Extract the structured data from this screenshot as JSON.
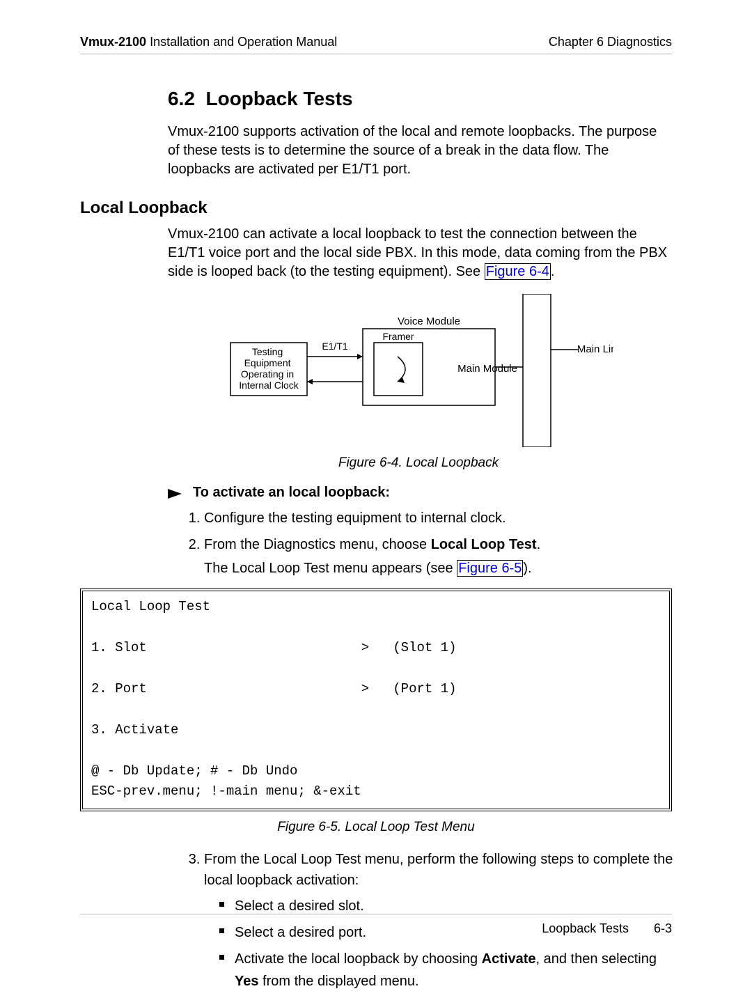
{
  "header": {
    "product": "Vmux-2100",
    "manual": " Installation and Operation Manual",
    "chapter": "Chapter 6  Diagnostics"
  },
  "section": {
    "number": "6.2",
    "title": "Loopback Tests",
    "intro": "Vmux-2100 supports activation of the local and remote loopbacks. The purpose of these tests is to determine the source of a break in the data flow. The loopbacks are activated per E1/T1 port."
  },
  "sub": {
    "title": "Local Loopback",
    "para_a": "Vmux-2100 can activate a local loopback to test the connection between the E1/T1 voice port and the local side PBX. In this mode, data coming from the PBX side is looped back (to the testing equipment). See ",
    "para_ref": "Figure 6-4",
    "para_b": "."
  },
  "diagram": {
    "testing": "Testing\nEquipment\nOperating in\nInternal Clock",
    "e1t1": "E1/T1",
    "voice": "Voice Module",
    "framer": "Framer",
    "mainmod": "Main Module",
    "mainlink": "Main Link"
  },
  "fig4": "Figure 6-4.  Local Loopback",
  "proc": {
    "lead": "To activate an local loopback:",
    "s1": "Configure the testing equipment to internal clock.",
    "s2a": "From the Diagnostics menu, choose ",
    "s2b": "Local Loop Test",
    "s2c": ".",
    "s2d": "The Local Loop Test menu appears (see ",
    "s2ref": "Figure 6-5",
    "s2e": ")."
  },
  "terminal": "Local Loop Test\n\n1. Slot                           >   (Slot 1)\n\n2. Port                           >   (Port 1)\n\n3. Activate\n\n@ - Db Update; # - Db Undo\nESC-prev.menu; !-main menu; &-exit",
  "fig5": "Figure 6-5.  Local Loop Test Menu",
  "s3": {
    "text": "From the Local Loop Test menu, perform the following steps to complete the local loopback activation:",
    "b1": "Select a desired slot.",
    "b2": "Select a desired port.",
    "b3a": "Activate the local loopback by choosing ",
    "b3b": "Activate",
    "b3c": ", and then selecting ",
    "b3d": "Yes",
    "b3e": " from the displayed menu."
  },
  "footer": {
    "title": "Loopback Tests",
    "page": "6-3"
  }
}
